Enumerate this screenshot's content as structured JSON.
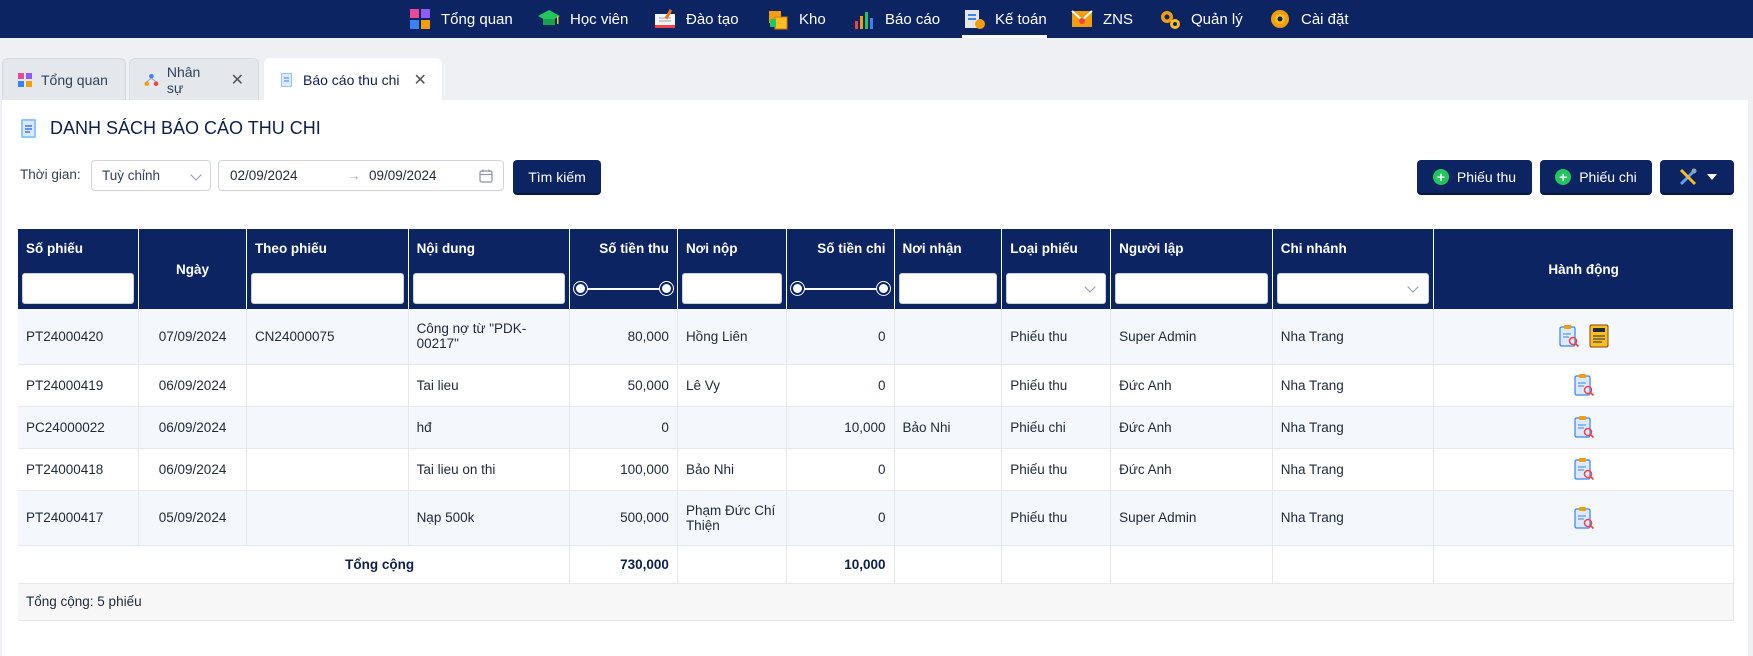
{
  "nav": [
    {
      "label": "Tổng quan",
      "icon": "dashboard-icon",
      "active": false
    },
    {
      "label": "Học viên",
      "icon": "graduation-cap-icon",
      "active": false
    },
    {
      "label": "Đào tạo",
      "icon": "book-icon",
      "active": false
    },
    {
      "label": "Kho",
      "icon": "boxes-icon",
      "active": false
    },
    {
      "label": "Báo cáo",
      "icon": "bar-chart-icon",
      "active": false
    },
    {
      "label": "Kế toán",
      "icon": "accounting-icon",
      "active": true
    },
    {
      "label": "ZNS",
      "icon": "mail-icon",
      "active": false
    },
    {
      "label": "Quản lý",
      "icon": "gears-icon",
      "active": false
    },
    {
      "label": "Cài đặt",
      "icon": "gear-icon",
      "active": false
    }
  ],
  "tabs": [
    {
      "label": "Tổng quan",
      "icon": "dashboard-icon",
      "closable": false,
      "active": false
    },
    {
      "label": "Nhân sự",
      "icon": "org-chart-icon",
      "closable": true,
      "active": false
    },
    {
      "label": "Báo cáo thu chi",
      "icon": "document-icon",
      "closable": true,
      "active": true
    }
  ],
  "tab_close_glyph": "✕",
  "page_title": "DANH SÁCH BÁO CÁO THU CHI",
  "filter": {
    "time_label": "Thời gian:",
    "period": "Tuỳ chỉnh",
    "date_from": "02/09/2024",
    "date_sep": "→",
    "date_to": "09/09/2024",
    "search_label": "Tìm kiếm"
  },
  "actions": {
    "receipt_label": "Phiếu thu",
    "payment_label": "Phiếu chi"
  },
  "columns": [
    "Số phiếu",
    "Ngày",
    "Theo phiếu",
    "Nội dung",
    "Số tiền thu",
    "Nơi nộp",
    "Số tiền chi",
    "Nơi nhận",
    "Loại phiếu",
    "Người lập",
    "Chi nhánh",
    "Hành động"
  ],
  "rows": [
    {
      "so_phieu": "PT24000420",
      "ngay": "07/09/2024",
      "theo_phieu": "CN24000075",
      "noi_dung": "Công nợ từ \"PDK-00217\"",
      "so_tien_thu": "80,000",
      "noi_nop": "Hồng Liên",
      "so_tien_chi": "0",
      "noi_nhan": "",
      "loai_phieu": "Phiếu thu",
      "nguoi_lap": "Super Admin",
      "chi_nhanh": "Nha Trang",
      "info": true
    },
    {
      "so_phieu": "PT24000419",
      "ngay": "06/09/2024",
      "theo_phieu": "",
      "noi_dung": "Tai lieu",
      "so_tien_thu": "50,000",
      "noi_nop": "Lê Vy",
      "so_tien_chi": "0",
      "noi_nhan": "",
      "loai_phieu": "Phiếu thu",
      "nguoi_lap": "Đức Anh",
      "chi_nhanh": "Nha Trang",
      "info": false
    },
    {
      "so_phieu": "PC24000022",
      "ngay": "06/09/2024",
      "theo_phieu": "",
      "noi_dung": "hđ",
      "so_tien_thu": "0",
      "noi_nop": "",
      "so_tien_chi": "10,000",
      "noi_nhan": "Bảo Nhi",
      "loai_phieu": "Phiếu chi",
      "nguoi_lap": "Đức Anh",
      "chi_nhanh": "Nha Trang",
      "info": false
    },
    {
      "so_phieu": "PT24000418",
      "ngay": "06/09/2024",
      "theo_phieu": "",
      "noi_dung": "Tai lieu on thi",
      "so_tien_thu": "100,000",
      "noi_nop": "Bảo Nhi",
      "so_tien_chi": "0",
      "noi_nhan": "",
      "loai_phieu": "Phiếu thu",
      "nguoi_lap": "Đức Anh",
      "chi_nhanh": "Nha Trang",
      "info": false
    },
    {
      "so_phieu": "PT24000417",
      "ngay": "05/09/2024",
      "theo_phieu": "",
      "noi_dung": "Nạp 500k",
      "so_tien_thu": "500,000",
      "noi_nop": "Phạm Đức Chí Thiện",
      "so_tien_chi": "0",
      "noi_nhan": "",
      "loai_phieu": "Phiếu thu",
      "nguoi_lap": "Super Admin",
      "chi_nhanh": "Nha Trang",
      "info": false
    }
  ],
  "totals": {
    "label": "Tổng cộng",
    "thu": "730,000",
    "chi": "10,000"
  },
  "count_text": "Tổng cộng: 5 phiếu",
  "colors": {
    "navy": "#0c2461",
    "green": "#22c55e"
  }
}
